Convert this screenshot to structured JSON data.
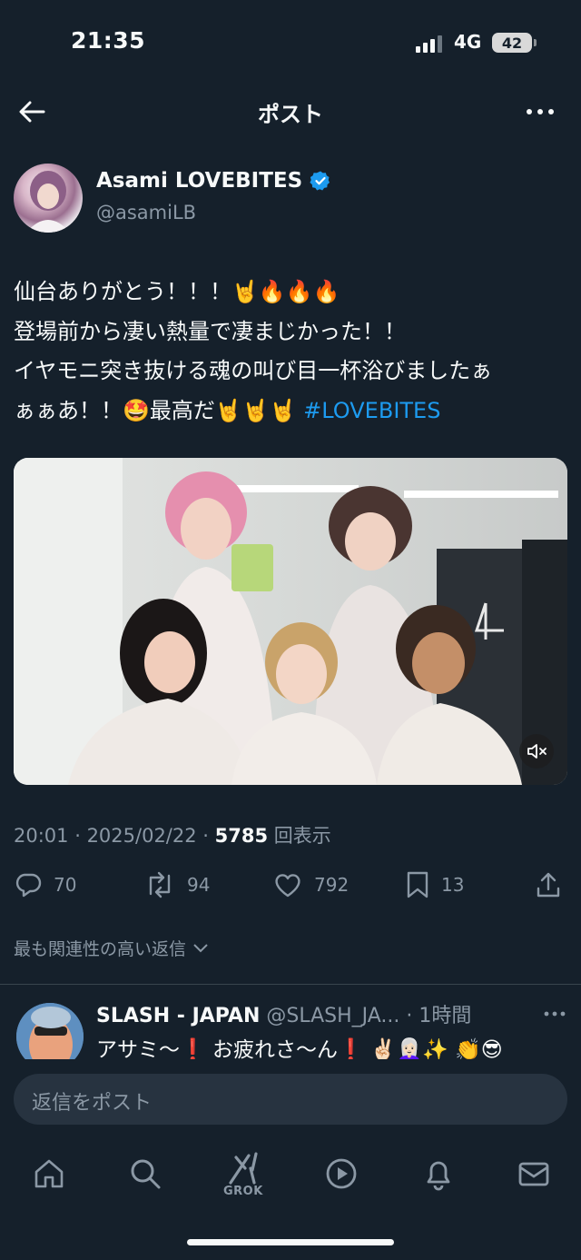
{
  "status": {
    "time": "21:35",
    "network": "4G",
    "battery": "42"
  },
  "header": {
    "title": "ポスト"
  },
  "author": {
    "name": "Asami LOVEBITES",
    "handle": "@asamiLB"
  },
  "post": {
    "line1": "仙台ありがとう！！！🤘🔥🔥🔥",
    "line2": "登場前から凄い熱量で凄まじかった！！",
    "line3": "イヤモニ突き抜ける魂の叫び目一杯浴びましたぁ",
    "line4_text": "ぁぁあ！！🤩最高だ🤘🤘🤘 ",
    "hashtag": "#LOVEBITES"
  },
  "meta": {
    "time": "20:01",
    "date": "2025/02/22",
    "views": "5785",
    "views_label": "回表示"
  },
  "actions": {
    "replies": "70",
    "reposts": "94",
    "likes": "792",
    "bookmarks": "13"
  },
  "sort": {
    "label": "最も関連性の高い返信"
  },
  "reply": {
    "name": "SLASH - JAPAN",
    "handle": "@SLASH_JA...",
    "time": "1時間",
    "text": "アサミ〜❗️ お疲れさ〜ん❗️ ✌🏻👩🏻‍🦳✨  👏😎"
  },
  "compose": {
    "placeholder": "返信をポスト"
  },
  "tabs": {
    "grok_label": "GROK"
  },
  "colors": {
    "background": "#15202b",
    "accent": "#1d9bf0",
    "muted": "#8b98a5"
  }
}
